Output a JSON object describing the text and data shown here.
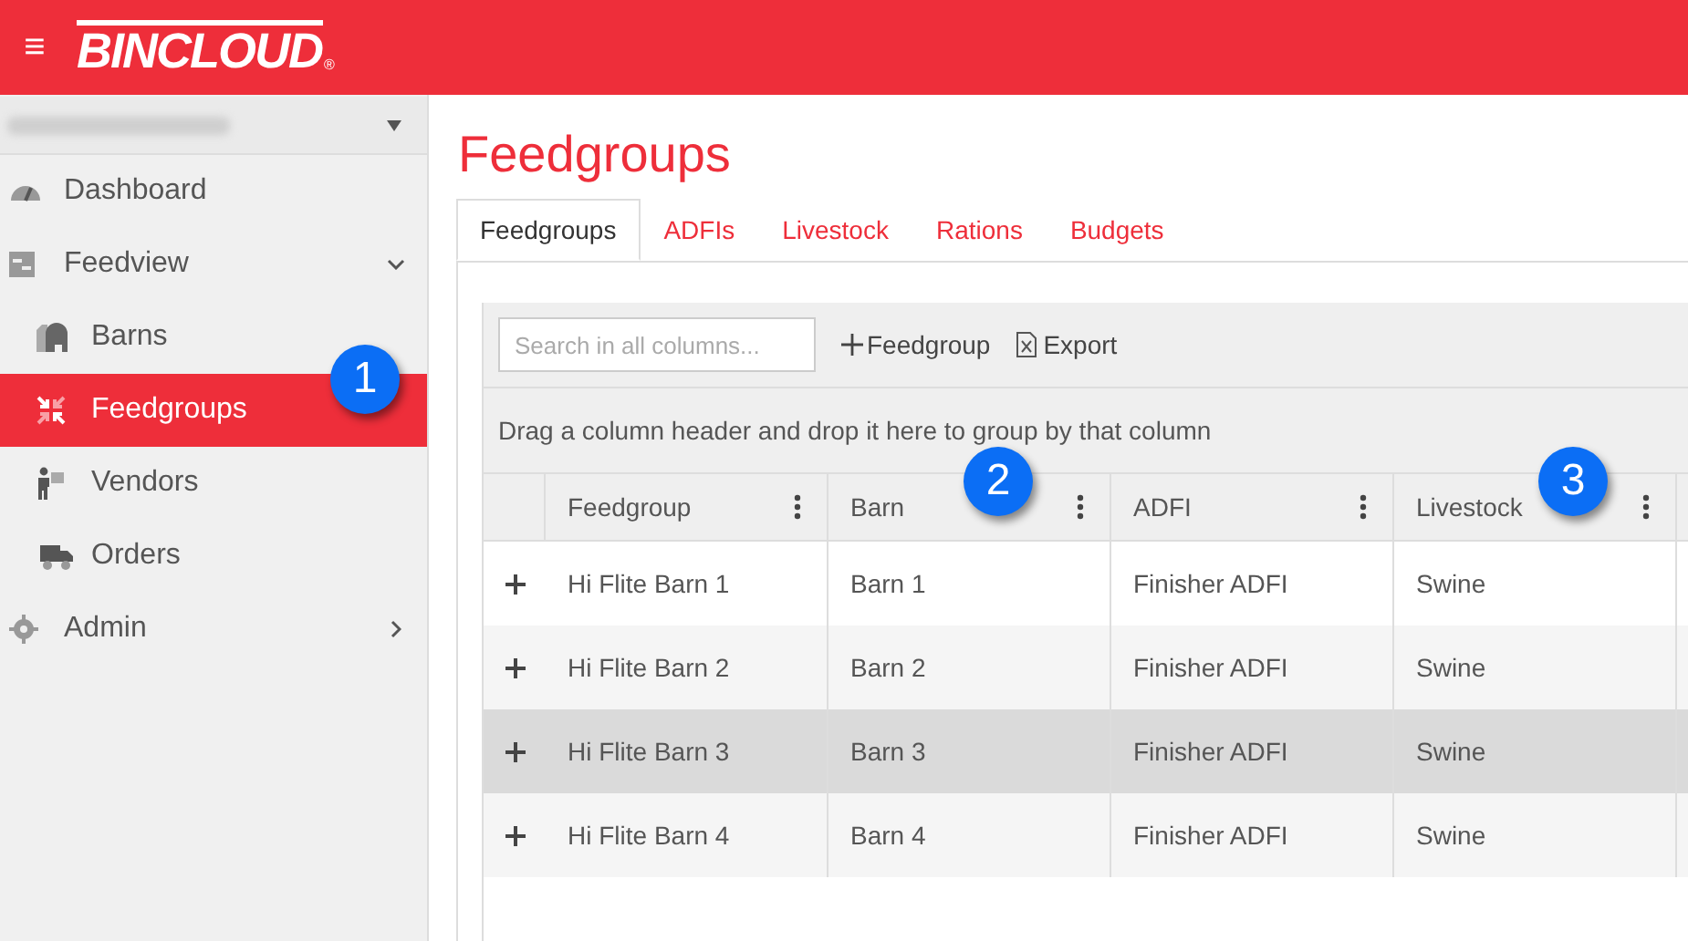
{
  "header": {
    "menu_icon": "≡",
    "logo": "BINCLOUD",
    "logo_mark": "®"
  },
  "sidebar": {
    "account_select": {
      "expanded": false
    },
    "items": [
      {
        "label": "Dashboard",
        "selected": false
      },
      {
        "label": "Feedview",
        "selected": false,
        "expanded": true,
        "children": [
          {
            "label": "Barns",
            "selected": false
          },
          {
            "label": "Feedgroups",
            "selected": true
          },
          {
            "label": "Vendors",
            "selected": false
          },
          {
            "label": "Orders",
            "selected": false
          }
        ]
      },
      {
        "label": "Admin",
        "selected": false,
        "expanded": false
      }
    ]
  },
  "page_title": "Feedgroups",
  "tabs": [
    {
      "label": "Feedgroups",
      "selected": true
    },
    {
      "label": "ADFIs",
      "selected": false
    },
    {
      "label": "Livestock",
      "selected": false
    },
    {
      "label": "Rations",
      "selected": false
    },
    {
      "label": "Budgets",
      "selected": false
    }
  ],
  "toolbar": {
    "search": {
      "placeholder": "Search in all columns..."
    },
    "add_button": "Feedgroup",
    "export_button": "Export"
  },
  "group_panel": "Drag a column header and drop it here to group by that column",
  "table": {
    "columns": [
      "Feedgroup",
      "Barn",
      "ADFI",
      "Livestock"
    ],
    "rows": [
      {
        "highlighted": false,
        "cells": [
          "Hi Flite Barn 1",
          "Barn 1",
          "Finisher ADFI",
          "Swine"
        ]
      },
      {
        "highlighted": false,
        "cells": [
          "Hi Flite Barn 2",
          "Barn 2",
          "Finisher ADFI",
          "Swine"
        ]
      },
      {
        "highlighted": true,
        "cells": [
          "Hi Flite Barn 3",
          "Barn 3",
          "Finisher ADFI",
          "Swine"
        ]
      },
      {
        "highlighted": false,
        "cells": [
          "Hi Flite Barn 4",
          "Barn 4",
          "Finisher ADFI",
          "Swine"
        ]
      }
    ]
  },
  "callouts": [
    "1",
    "2",
    "3"
  ]
}
